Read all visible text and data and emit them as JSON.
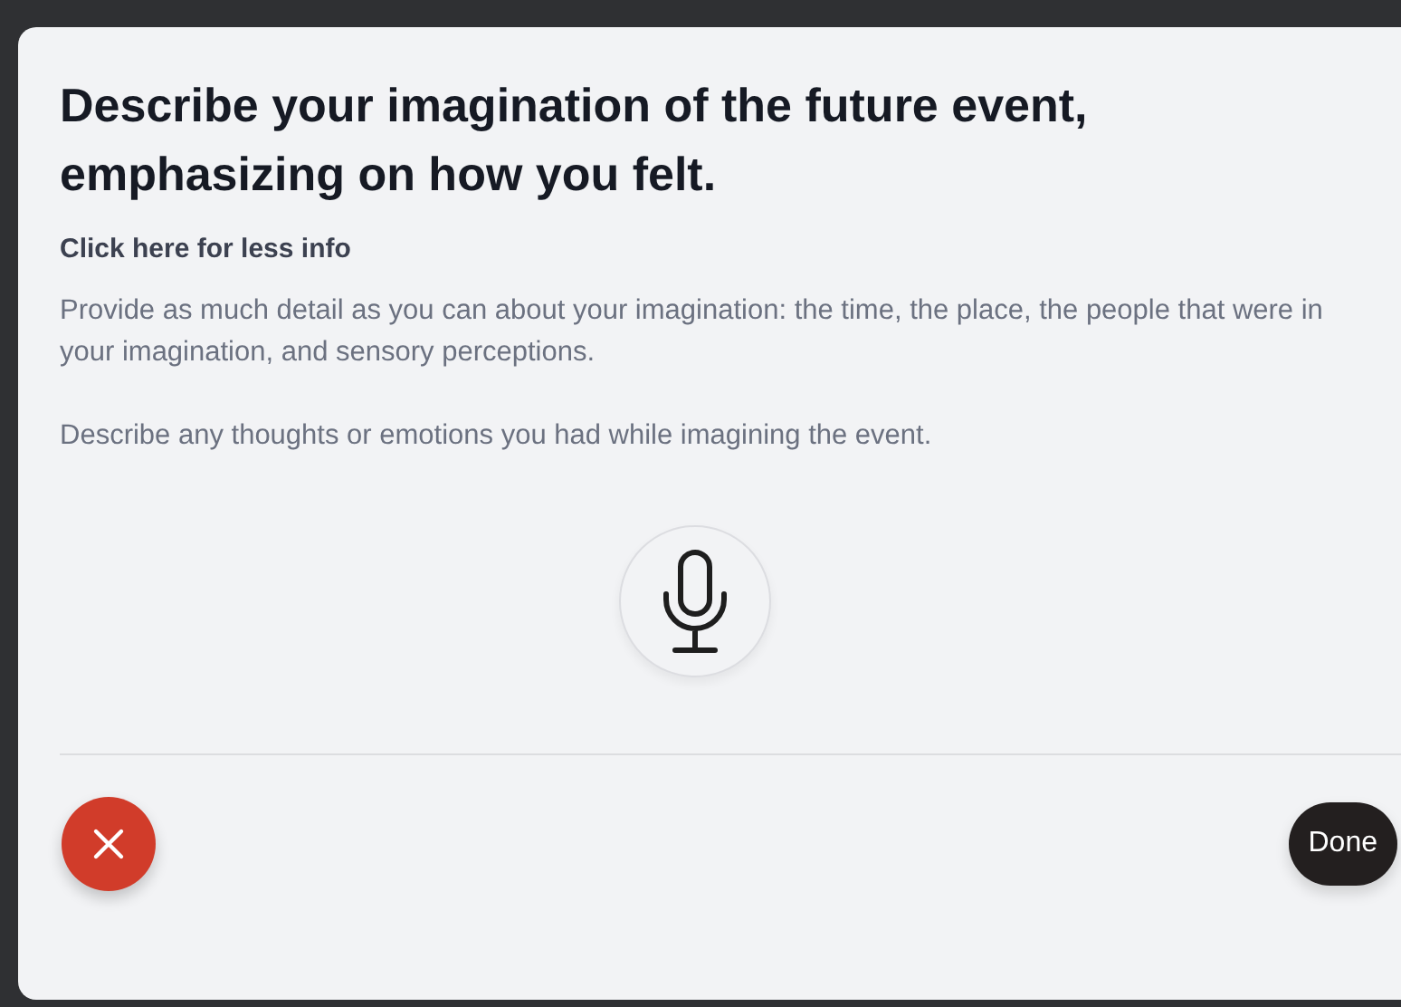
{
  "title": "Describe your imagination of the future event, emphasizing on how you felt.",
  "info_link": "Click here for less info",
  "paragraphs": [
    "Provide as much detail as you can about your imagination: the time, the place, the people that were in your imagination, and sensory perceptions.",
    "Describe any thoughts or emotions you had while imagining the event."
  ],
  "done_button": "Done"
}
